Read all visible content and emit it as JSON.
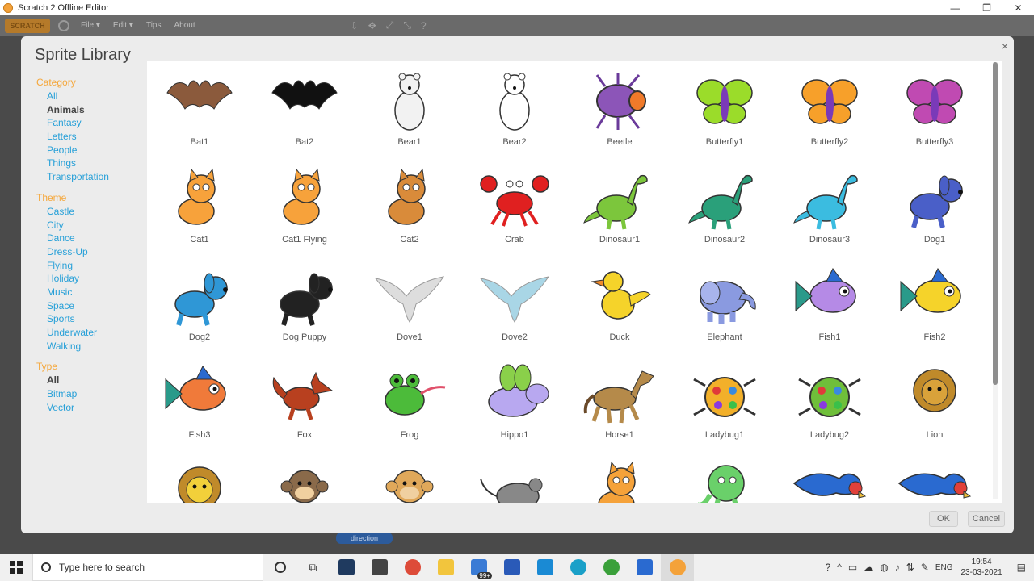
{
  "window": {
    "title": "Scratch 2 Offline Editor",
    "minimize_glyph": "—",
    "restore_glyph": "❐",
    "close_glyph": "✕"
  },
  "menubar": {
    "logo": "SCRATCH",
    "items": [
      "File ▾",
      "Edit ▾",
      "Tips",
      "About"
    ],
    "tools": [
      "⇩",
      "✥",
      "⤢",
      "⤡",
      "?"
    ]
  },
  "background": {
    "block_label": "direction"
  },
  "dialog": {
    "title": "Sprite Library",
    "close_glyph": "×",
    "ok_label": "OK",
    "cancel_label": "Cancel"
  },
  "sidebar": {
    "category_label": "Category",
    "categories": [
      "All",
      "Animals",
      "Fantasy",
      "Letters",
      "People",
      "Things",
      "Transportation"
    ],
    "selected_category": "Animals",
    "theme_label": "Theme",
    "themes": [
      "Castle",
      "City",
      "Dance",
      "Dress-Up",
      "Flying",
      "Holiday",
      "Music",
      "Space",
      "Sports",
      "Underwater",
      "Walking"
    ],
    "type_label": "Type",
    "types": [
      "All",
      "Bitmap",
      "Vector"
    ],
    "selected_type": "All"
  },
  "sprites": [
    {
      "name": "Bat1",
      "icon": "bat-icon",
      "color": "#8b5a3c"
    },
    {
      "name": "Bat2",
      "icon": "bat-icon",
      "color": "#111111"
    },
    {
      "name": "Bear1",
      "icon": "bear-icon",
      "color": "#f2f2f2"
    },
    {
      "name": "Bear2",
      "icon": "bear-icon",
      "color": "#ffffff"
    },
    {
      "name": "Beetle",
      "icon": "beetle-icon",
      "color": "#8c55b8"
    },
    {
      "name": "Butterfly1",
      "icon": "butterfly-icon",
      "color": "#9bdc2a"
    },
    {
      "name": "Butterfly2",
      "icon": "butterfly-icon",
      "color": "#f7a02a"
    },
    {
      "name": "Butterfly3",
      "icon": "butterfly-icon",
      "color": "#c04ab2"
    },
    {
      "name": "Cat1",
      "icon": "cat-icon",
      "color": "#f7a23b"
    },
    {
      "name": "Cat1 Flying",
      "icon": "cat-icon",
      "color": "#f7a23b"
    },
    {
      "name": "Cat2",
      "icon": "cat-icon",
      "color": "#d98b3a"
    },
    {
      "name": "Crab",
      "icon": "crab-icon",
      "color": "#e02020"
    },
    {
      "name": "Dinosaur1",
      "icon": "dinosaur-icon",
      "color": "#7cc63c"
    },
    {
      "name": "Dinosaur2",
      "icon": "dinosaur-icon",
      "color": "#2aa07a"
    },
    {
      "name": "Dinosaur3",
      "icon": "dinosaur-icon",
      "color": "#3bbce0"
    },
    {
      "name": "Dog1",
      "icon": "dog-icon",
      "color": "#4a5fc8"
    },
    {
      "name": "Dog2",
      "icon": "dog-icon",
      "color": "#2f97d6"
    },
    {
      "name": "Dog Puppy",
      "icon": "dog-icon",
      "color": "#222222"
    },
    {
      "name": "Dove1",
      "icon": "dove-icon",
      "color": "#dddddd"
    },
    {
      "name": "Dove2",
      "icon": "dove-icon",
      "color": "#a9d6e6"
    },
    {
      "name": "Duck",
      "icon": "duck-icon",
      "color": "#f5d32a"
    },
    {
      "name": "Elephant",
      "icon": "elephant-icon",
      "color": "#8a9ae0"
    },
    {
      "name": "Fish1",
      "icon": "fish-icon",
      "color": "#b58ae6"
    },
    {
      "name": "Fish2",
      "icon": "fish-icon",
      "color": "#f5d32a"
    },
    {
      "name": "Fish3",
      "icon": "fish-icon",
      "color": "#f07a3a"
    },
    {
      "name": "Fox",
      "icon": "fox-icon",
      "color": "#b8401f"
    },
    {
      "name": "Frog",
      "icon": "frog-icon",
      "color": "#4cbb3a"
    },
    {
      "name": "Hippo1",
      "icon": "hippo-icon",
      "color": "#b8a8f0"
    },
    {
      "name": "Horse1",
      "icon": "horse-icon",
      "color": "#b58a4a"
    },
    {
      "name": "Ladybug1",
      "icon": "ladybug-icon",
      "color": "#f2b02a"
    },
    {
      "name": "Ladybug2",
      "icon": "ladybug-icon",
      "color": "#6fbf3a"
    },
    {
      "name": "Lion",
      "icon": "lion-icon",
      "color": "#d9a23a"
    },
    {
      "name": "",
      "icon": "lion-icon",
      "color": "#f2d03a"
    },
    {
      "name": "",
      "icon": "monkey-icon",
      "color": "#8a6a4a"
    },
    {
      "name": "",
      "icon": "monkey-icon",
      "color": "#e0a85a"
    },
    {
      "name": "",
      "icon": "mouse-icon",
      "color": "#888888"
    },
    {
      "name": "",
      "icon": "cat-icon",
      "color": "#f5a23a"
    },
    {
      "name": "",
      "icon": "octopus-icon",
      "color": "#6ad06a"
    },
    {
      "name": "",
      "icon": "parrot-icon",
      "color": "#2a6ad0"
    },
    {
      "name": "",
      "icon": "parrot-icon",
      "color": "#2a6ad0"
    }
  ],
  "taskbar": {
    "search_placeholder": "Type here to search",
    "mail_badge": "99+",
    "language": "ENG",
    "time": "19:54",
    "date": "23-03-2021"
  }
}
